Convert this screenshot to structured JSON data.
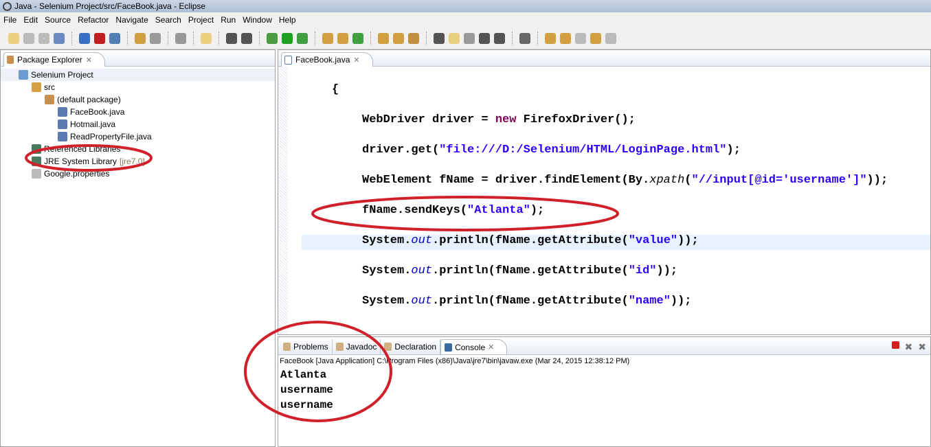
{
  "window": {
    "title": "Java - Selenium Project/src/FaceBook.java - Eclipse"
  },
  "menu": [
    "File",
    "Edit",
    "Source",
    "Refactor",
    "Navigate",
    "Search",
    "Project",
    "Run",
    "Window",
    "Help"
  ],
  "package_explorer": {
    "tab": "Package Explorer",
    "items": [
      {
        "label": "Selenium Project",
        "depth": 0,
        "icon": "project-icon",
        "color": "#6a9ad0"
      },
      {
        "label": "src",
        "depth": 1,
        "icon": "source-folder-icon",
        "color": "#d8a040"
      },
      {
        "label": "(default package)",
        "depth": 2,
        "icon": "package-icon",
        "color": "#c89050"
      },
      {
        "label": "FaceBook.java",
        "depth": 3,
        "icon": "java-file-icon",
        "color": "#5a7ab0"
      },
      {
        "label": "Hotmail.java",
        "depth": 3,
        "icon": "java-file-icon",
        "color": "#5a7ab0"
      },
      {
        "label": "ReadPropertyFile.java",
        "depth": 3,
        "icon": "java-file-icon",
        "color": "#5a7ab0"
      },
      {
        "label": "Referenced Libraries",
        "depth": 1,
        "icon": "library-icon",
        "color": "#4a7a60"
      },
      {
        "label": "JRE System Library",
        "suffix": "[jre7.0]",
        "depth": 1,
        "icon": "library-icon",
        "color": "#4a7a60"
      },
      {
        "label": "Google.properties",
        "depth": 1,
        "icon": "properties-file-icon",
        "color": "#bbbbbb"
      }
    ]
  },
  "editor": {
    "tab": "FaceBook.java",
    "lines": [
      {
        "indent": 0,
        "segs": [
          {
            "c": "",
            "s": "{"
          }
        ]
      },
      {
        "indent": 1,
        "segs": [
          {
            "c": "",
            "s": "WebDriver driver = "
          },
          {
            "c": "kw",
            "s": "new"
          },
          {
            "c": "",
            "s": " FirefoxDriver();"
          }
        ]
      },
      {
        "indent": 1,
        "segs": [
          {
            "c": "",
            "s": "driver.get("
          },
          {
            "c": "st",
            "s": "\"file:///D:/Selenium/HTML/LoginPage.html\""
          },
          {
            "c": "",
            "s": ");"
          }
        ]
      },
      {
        "indent": 1,
        "segs": [
          {
            "c": "",
            "s": "WebElement fName = driver.findElement(By."
          },
          {
            "c": "mi",
            "s": "xpath"
          },
          {
            "c": "",
            "s": "("
          },
          {
            "c": "st",
            "s": "\"//input[@id='username']\""
          },
          {
            "c": "",
            "s": "));"
          }
        ]
      },
      {
        "indent": 1,
        "segs": [
          {
            "c": "",
            "s": "fName.sendKeys("
          },
          {
            "c": "st",
            "s": "\"Atlanta\""
          },
          {
            "c": "",
            "s": ");"
          }
        ]
      },
      {
        "indent": 1,
        "segs": [
          {
            "c": "",
            "s": "System."
          },
          {
            "c": "it",
            "s": "out"
          },
          {
            "c": "",
            "s": ".println(fName.getAttribute("
          },
          {
            "c": "st",
            "s": "\"value\""
          },
          {
            "c": "",
            "s": "));"
          }
        ]
      },
      {
        "indent": 1,
        "segs": [
          {
            "c": "",
            "s": "System."
          },
          {
            "c": "it",
            "s": "out"
          },
          {
            "c": "",
            "s": ".println(fName.getAttribute("
          },
          {
            "c": "st",
            "s": "\"id\""
          },
          {
            "c": "",
            "s": "));"
          }
        ]
      },
      {
        "indent": 1,
        "segs": [
          {
            "c": "",
            "s": "System."
          },
          {
            "c": "it",
            "s": "out"
          },
          {
            "c": "",
            "s": ".println(fName.getAttribute("
          },
          {
            "c": "st",
            "s": "\"name\""
          },
          {
            "c": "",
            "s": "));"
          }
        ]
      }
    ]
  },
  "console": {
    "tabs": [
      "Problems",
      "Javadoc",
      "Declaration",
      "Console"
    ],
    "active": "Console",
    "info": "FaceBook [Java Application] C:\\Program Files (x86)\\Java\\jre7\\bin\\javaw.exe (Mar 24, 2015 12:38:12 PM)",
    "output": [
      "Atlanta",
      "username",
      "username"
    ]
  },
  "colors": {
    "keyword": "#7f0055",
    "string": "#2a00ff",
    "field": "#0000c0",
    "annotation": "#d0202a"
  }
}
